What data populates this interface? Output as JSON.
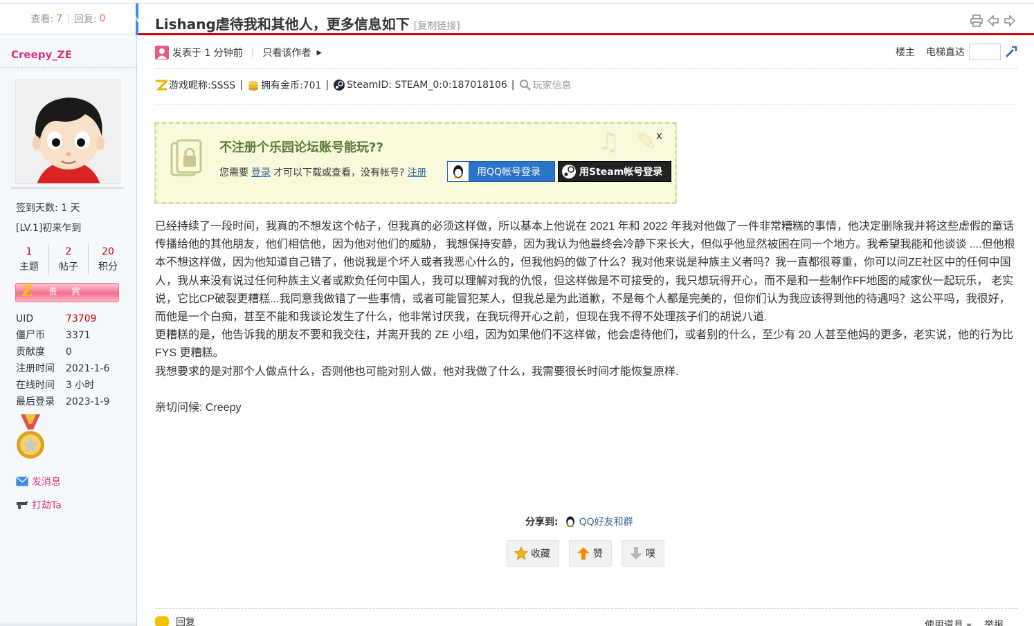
{
  "thread": {
    "views_label": "查看:",
    "views": "7",
    "replies_label": "回复:",
    "replies": "0",
    "title": "Lishang虐待我和其他人，更多信息如下",
    "copy_link": "[复制链接]"
  },
  "author": {
    "name": "Creepy_ZE",
    "checkin": "签到天数: 1 天",
    "level": "[LV.1]初来乍到",
    "counts": [
      {
        "value": "1",
        "label": "主题"
      },
      {
        "value": "2",
        "label": "帖子"
      },
      {
        "value": "20",
        "label": "积分"
      }
    ],
    "group": "贵 宾",
    "info": [
      {
        "key": "UID",
        "value": "73709",
        "red": true
      },
      {
        "key": "僵尸币",
        "value": "3371",
        "red": false
      },
      {
        "key": "贡献度",
        "value": "0",
        "red": false
      },
      {
        "key": "注册时间",
        "value": "2021-1-6",
        "red": false
      },
      {
        "key": "在线时间",
        "value": "3 小时",
        "red": false
      },
      {
        "key": "最后登录",
        "value": "2023-1-9",
        "red": false
      }
    ],
    "send_message": "发消息",
    "rob": "打劫Ta"
  },
  "post_meta": {
    "posted": "发表于 1 分钟前",
    "author_only": "只看该作者",
    "floor": "楼主",
    "elevator": "电梯直达"
  },
  "game_info": {
    "nickname": "游戏昵称:SSSS",
    "coins": "拥有金币:701",
    "steamid": "SteamID: STEAM_0:0:187018106",
    "player_info": "玩家信息"
  },
  "login_prompt": {
    "title": "不注册个乐园论坛账号能玩??",
    "text_before": "您需要",
    "login_link": "登录",
    "text_middle": "才可以下载或查看，没有帐号?",
    "register_link": "注册",
    "qq_button": "用QQ帐号登录",
    "steam_button": "用Steam帐号登录",
    "close": "x"
  },
  "post": {
    "paragraphs": [
      "已经持续了一段时间，我真的不想发这个帖子，但我真的必须这样做，所以基本上他说在 2021 年和 2022 年我对他做了一件非常糟糕的事情，他决定删除我并将这些虚假的童话传播给他的其他朋友，他们相信他，因为他对他们的威胁， 我想保持安静，因为我认为他最终会冷静下来长大，但似乎他显然被困在同一个地方。我希望我能和他谈谈 ....但他根本不想这样做，因为他知道自己错了，他说我是个坏人或者我恶心什么的，但我他妈的做了什么？我对他来说是种族主义者吗？我一直都很尊重，你可以问ZE社区中的任何中国人，我从来没有说过任何种族主义者或欺负任何中国人，我可以理解对我的仇恨，但这样做是不可接受的，我只想玩得开心，而不是和一些制作FF地图的咸家伙一起玩乐， 老实说，它比CP破裂更糟糕...我同意我做错了一些事情，或者可能冒犯某人，但我总是为此道歉，不是每个人都是完美的，但你们认为我应该得到他的待遇吗？这公平吗，我很好，而他是一个白痴，甚至不能和我谈论发生了什么，他非常讨厌我，在我玩得开心之前，但现在我不得不处理孩子们的胡说八道.",
      "更糟糕的是，他告诉我的朋友不要和我交往，并离开我的 ZE 小组，因为如果他们不这样做，他会虐待他们，或者别的什么，至少有 20 人甚至他妈的更多，老实说，他的行为比 FYS 更糟糕。",
      "我想要求的是对那个人做点什么，否则他也可能对别人做，他对我做了什么，我需要很长时间才能恢复原样."
    ],
    "signoff": "亲切问候: Creepy"
  },
  "share": {
    "label": "分享到:",
    "qq": "QQ好友和群"
  },
  "actions": {
    "favorite": "收藏",
    "like": "赞",
    "dislike": "噗"
  },
  "footer": {
    "reply": "回复",
    "use_item": "使用道具",
    "report": "举报"
  },
  "colors": {
    "accent_red": "#cc0000",
    "username_pink": "#e0317e",
    "link_blue": "#336699"
  }
}
